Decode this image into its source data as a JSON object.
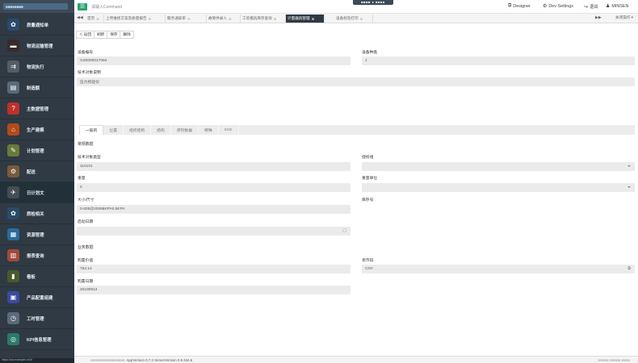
{
  "topbar": {
    "command_placeholder": "请输入Command",
    "menu_glyph": "☰",
    "drag_label": "■■■■ ● ■■■■",
    "designer": "Designer",
    "dev_settings": "Dev Settings",
    "logout": "退出",
    "user": "MINSEN"
  },
  "sidebar": {
    "logo_text": "■■■■■■■■",
    "url": "https://oa.example.cn/#/",
    "items": [
      {
        "label": "质量通知单",
        "color": "#2a4a6a",
        "glyph": "✿"
      },
      {
        "label": "物流运输管理",
        "color": "#3a2a2a",
        "glyph": "▬"
      },
      {
        "label": "物流执行",
        "color": "#555d66",
        "glyph": "⇉"
      },
      {
        "label": "制造额",
        "color": "#5a6a7a",
        "glyph": "▤"
      },
      {
        "label": "主数据管理",
        "color": "#c0302a",
        "glyph": "?"
      },
      {
        "label": "生产建模",
        "color": "#b34a1a",
        "glyph": "⌂"
      },
      {
        "label": "计划管理",
        "color": "#6a7a3a",
        "glyph": "✎"
      },
      {
        "label": "配送",
        "color": "#7a5a3a",
        "glyph": "⚙"
      },
      {
        "label": "日计划文",
        "color": "#444c54",
        "glyph": "✈"
      },
      {
        "label": "质检相关",
        "color": "#2a4a6a",
        "glyph": "✿"
      },
      {
        "label": "资源管理",
        "color": "#2a6aa0",
        "glyph": "▦"
      },
      {
        "label": "报表查询",
        "color": "#a04a3a",
        "glyph": "▥"
      },
      {
        "label": "看板",
        "color": "#4a5a2a",
        "glyph": "▮"
      },
      {
        "label": "产品配置组建",
        "color": "#3a4aa0",
        "glyph": "▣"
      },
      {
        "label": "工时管理",
        "color": "#5a6a7a",
        "glyph": "◷"
      },
      {
        "label": "KPI信息管理",
        "color": "#2a7a6a",
        "glyph": "◎"
      }
    ]
  },
  "tabs": {
    "items": [
      {
        "label": "首页"
      },
      {
        "label": "上传维修方案及质量报告"
      },
      {
        "label": "服务通知单"
      },
      {
        "label": "故障件录入"
      },
      {
        "label": "工装模具库存查询"
      },
      {
        "label": "计量器具管理"
      },
      {
        "label": "设备标签打印"
      }
    ],
    "close_ops": "关闭操作 ▾",
    "nav_left": "◀◀",
    "nav_right": "▶▶"
  },
  "toolbar": {
    "back": "＜ 返回",
    "refresh": "刷新",
    "save": "保存",
    "delete": "删除"
  },
  "form": {
    "equipment_no_label": "设备编号",
    "equipment_no": "GZ0000017084",
    "equipment_type_label": "设备种类",
    "equipment_type": "J",
    "tech_desc_label": "技术对象说明",
    "tech_desc": "压力校验仪",
    "subtabs": [
      "一般的",
      "位置",
      "组织结构",
      "结构",
      "序列数据",
      "特殊",
      "SCE"
    ],
    "general_data_title": "常规数据",
    "tech_obj_type_label": "技术对象类型",
    "tech_obj_type": "110101",
    "auth_group_label": "授权组",
    "weight_label": "重量",
    "weight": "0",
    "weight_unit_label": "重量单位",
    "size_label": "大小/尺寸",
    "size": "0-835@20068KPA0.5KPA",
    "inventory_no_label": "库存号",
    "start_date_label": "启动日期",
    "business_data_title": "业务数据",
    "acq_value_label": "购置价值",
    "acq_value": "752.14",
    "currency_label": "货币码",
    "currency": "CNY",
    "acq_date_label": "购置日期",
    "acq_date": "20100913"
  },
  "status": {
    "left": "■■■■■■■■■■■■■■■■",
    "version": "AppVersion 0.7.3 ServerVersion 0.9.344.6",
    "right": "■■■■■ ■■■■■ ■■■■"
  }
}
